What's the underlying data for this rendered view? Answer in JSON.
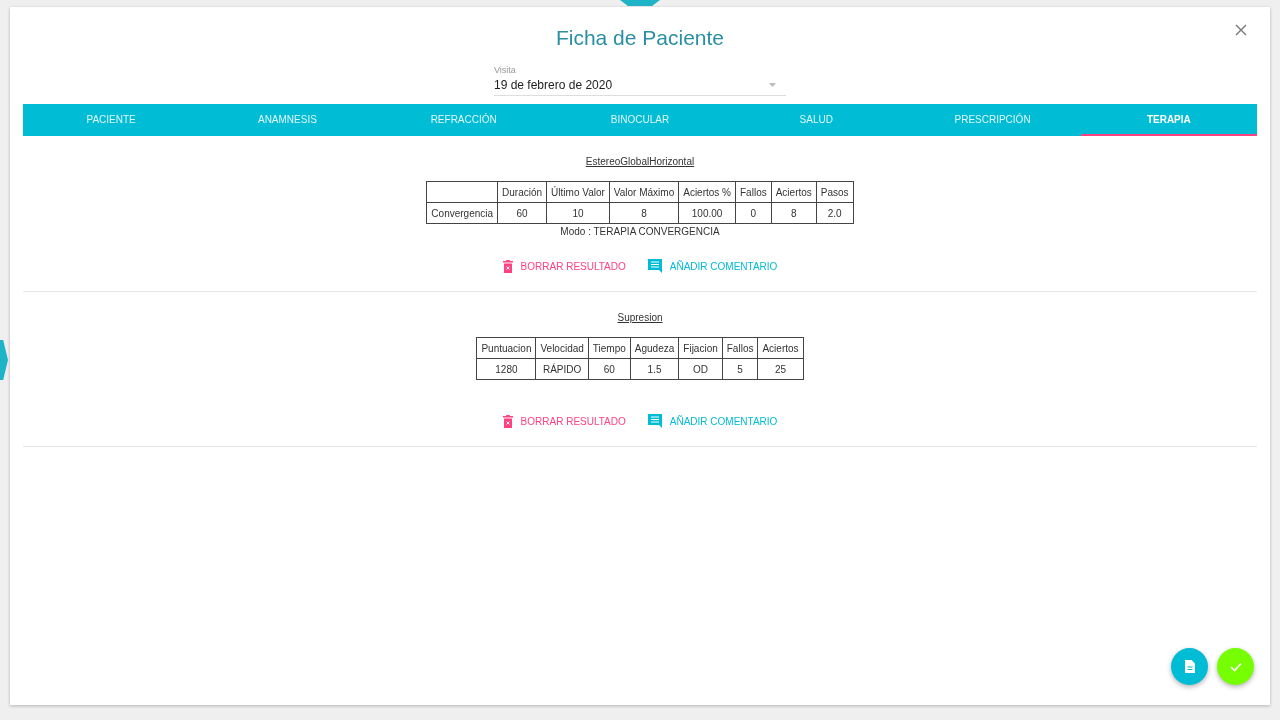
{
  "dialog": {
    "title": "Ficha de Paciente",
    "visit_field": {
      "label": "Visita",
      "value": "19 de febrero de 2020"
    }
  },
  "tabs": [
    {
      "label": "PACIENTE",
      "selected": false
    },
    {
      "label": "ANAMNESIS",
      "selected": false
    },
    {
      "label": "REFRACCIÓN",
      "selected": false
    },
    {
      "label": "BINOCULAR",
      "selected": false
    },
    {
      "label": "SALUD",
      "selected": false
    },
    {
      "label": "PRESCRIPCIÓN",
      "selected": false
    },
    {
      "label": "TERAPIA",
      "selected": true
    }
  ],
  "results": [
    {
      "title": "EstereoGlobalHorizontal",
      "columns": [
        "",
        "Duración",
        "Último Valor",
        "Valor Máximo",
        "Aciertos %",
        "Fallos",
        "Aciertos",
        "Pasos"
      ],
      "rows": [
        [
          "Convergencia",
          "60",
          "10",
          "8",
          "100.00",
          "0",
          "8",
          "2.0"
        ]
      ],
      "mode": "Modo : TERAPIA CONVERGENCIA",
      "delete_label": "BORRAR RESULTADO",
      "comment_label": "AÑADIR COMENTARIO"
    },
    {
      "title": "Supresion",
      "columns": [
        "Puntuacion",
        "Velocidad",
        "Tiempo",
        "Agudeza",
        "Fijacion",
        "Fallos",
        "Aciertos"
      ],
      "rows": [
        [
          "1280",
          "RÁPIDO",
          "60",
          "1.5",
          "OD",
          "5",
          "25"
        ]
      ],
      "delete_label": "BORRAR RESULTADO",
      "comment_label": "AÑADIR COMENTARIO"
    }
  ]
}
